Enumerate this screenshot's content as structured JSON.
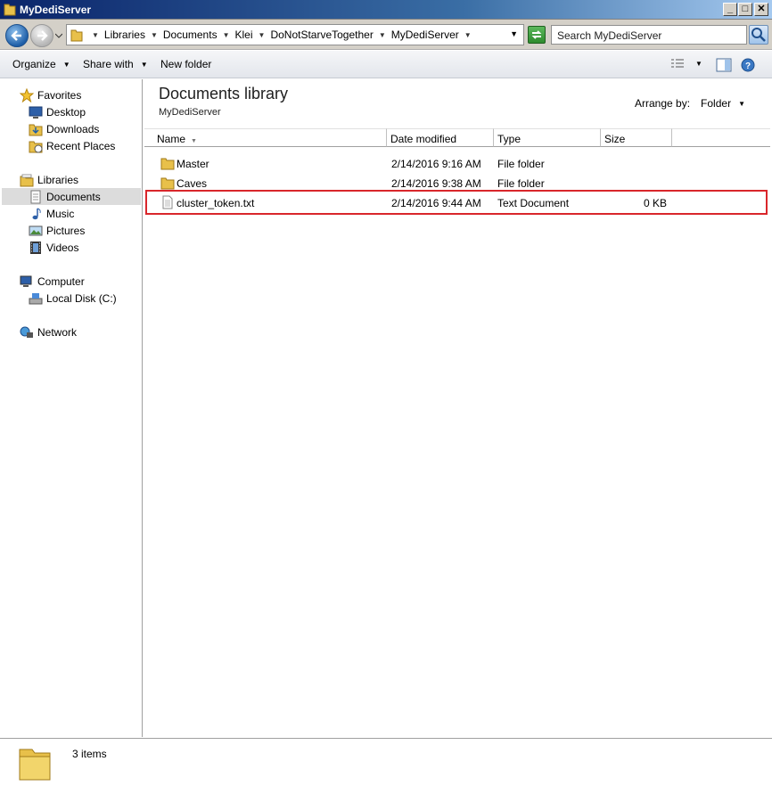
{
  "window": {
    "title": "MyDediServer"
  },
  "address": {
    "crumbs": [
      "Libraries",
      "Documents",
      "Klei",
      "DoNotStarveTogether",
      "MyDediServer"
    ],
    "search_placeholder": "Search MyDediServer"
  },
  "toolbar": {
    "organize": "Organize",
    "share": "Share with",
    "new_folder": "New folder"
  },
  "nav": {
    "favorites": "Favorites",
    "desktop": "Desktop",
    "downloads": "Downloads",
    "recent": "Recent Places",
    "libraries": "Libraries",
    "documents": "Documents",
    "music": "Music",
    "pictures": "Pictures",
    "videos": "Videos",
    "computer": "Computer",
    "local_disk": "Local Disk (C:)",
    "network": "Network"
  },
  "content": {
    "title": "Documents library",
    "subtitle": "MyDediServer",
    "arrange_label": "Arrange by:",
    "arrange_value": "Folder",
    "columns": {
      "name": "Name",
      "date": "Date modified",
      "type": "Type",
      "size": "Size"
    },
    "files": [
      {
        "name": "Master",
        "date": "2/14/2016 9:16 AM",
        "type": "File folder",
        "size": "",
        "icon": "folder-icon"
      },
      {
        "name": "Caves",
        "date": "2/14/2016 9:38 AM",
        "type": "File folder",
        "size": "",
        "icon": "folder-icon"
      },
      {
        "name": "cluster_token.txt",
        "date": "2/14/2016 9:44 AM",
        "type": "Text Document",
        "size": "0 KB",
        "icon": "text-file-icon"
      }
    ],
    "highlight_color": "#d9262b"
  },
  "status": {
    "count": "3 items"
  }
}
